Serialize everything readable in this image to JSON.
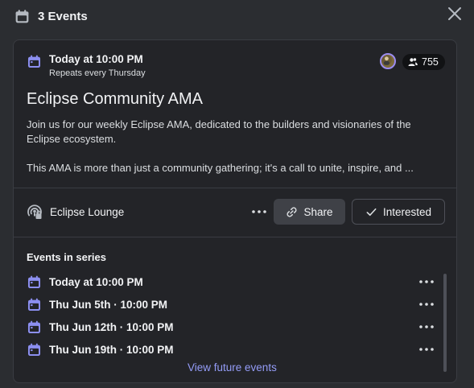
{
  "header": {
    "title": "3 Events",
    "icon": "calendar-icon",
    "close_icon": "close-icon"
  },
  "event": {
    "time": "Today at 10:00 PM",
    "repeat": "Repeats every Thursday",
    "interested_count": "755",
    "title": "Eclipse Community AMA",
    "description_1": "Join us for our weekly Eclipse AMA, dedicated to the builders and visionaries of the Eclipse ecosystem.",
    "description_2": "This AMA is more than just a community gathering; it's a call to unite, inspire, and ...",
    "location": "Eclipse Lounge",
    "share_label": "Share",
    "interested_label": "Interested"
  },
  "series": {
    "label": "Events in series",
    "items": [
      {
        "label": "Today at 10:00 PM"
      },
      {
        "label": "Thu Jun 5th · 10:00 PM"
      },
      {
        "label": "Thu Jun 12th · 10:00 PM"
      },
      {
        "label": "Thu Jun 19th · 10:00 PM"
      }
    ],
    "view_more": "View future events"
  },
  "colors": {
    "background": "#2b2d31",
    "card": "#232428",
    "accent": "#949cf7",
    "calendar_icon": "#8c8ff0"
  }
}
